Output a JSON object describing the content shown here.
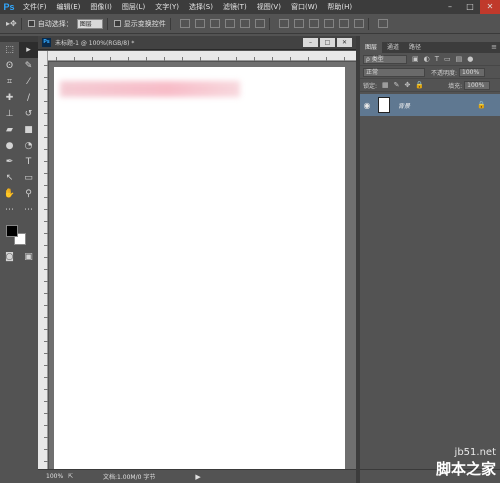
{
  "app": {
    "logo": "Ps"
  },
  "menu": [
    "文件(F)",
    "编辑(E)",
    "图像(I)",
    "图层(L)",
    "文字(Y)",
    "选择(S)",
    "滤镜(T)",
    "视图(V)",
    "窗口(W)",
    "帮助(H)"
  ],
  "window_controls": {
    "minimize": "–",
    "maximize": "□",
    "close": "✕"
  },
  "options_bar": {
    "auto_select_label": "自动选择：",
    "auto_select_value": "图层",
    "show_transform_label": "显示变换控件"
  },
  "document": {
    "tab_title": "未标题-1 @ 100%(RGB/8) *",
    "zoom": "100%",
    "info": "文档:1.00M/0 字节"
  },
  "layers_panel": {
    "tabs": [
      "图层",
      "通道",
      "路径"
    ],
    "filter_kind": "ρ 类型",
    "blend_mode": "正常",
    "opacity_label": "不透明度:",
    "opacity_value": "100%",
    "lock_label": "锁定:",
    "fill_label": "填充:",
    "fill_value": "100%",
    "layer_name": "背景"
  },
  "watermark": {
    "url": "jb51.net",
    "text": "脚本之家"
  },
  "colors": {
    "accent": "#31a8ff",
    "layer_selected": "#5f7891",
    "foreground": "#000000",
    "background": "#ffffff"
  }
}
